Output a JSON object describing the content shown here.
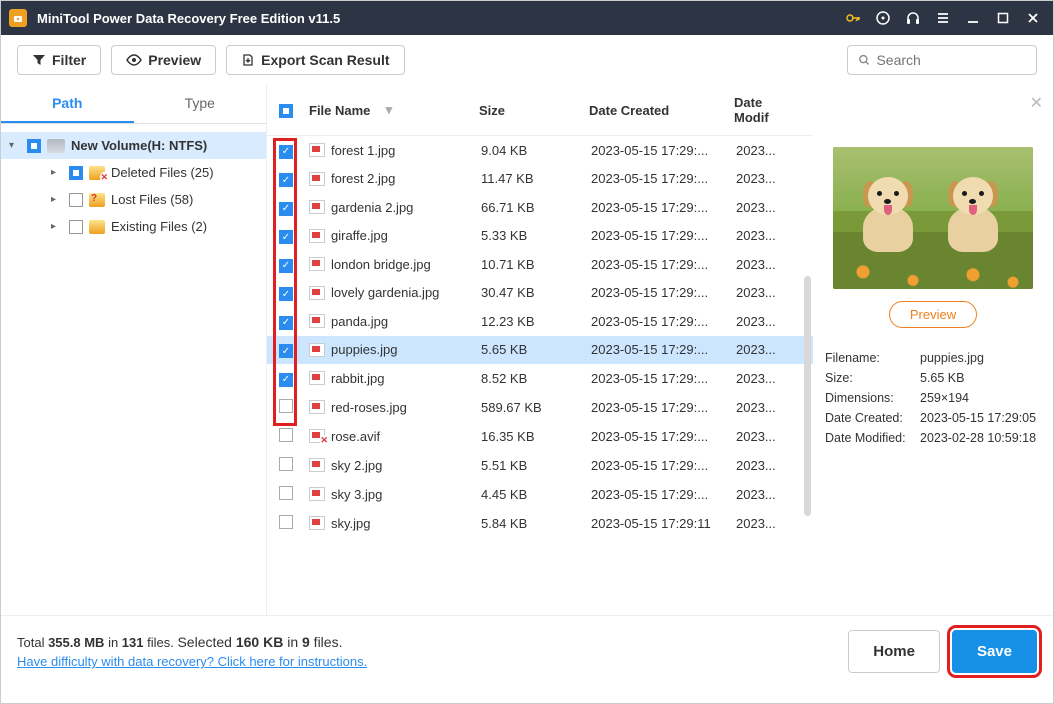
{
  "window": {
    "title": "MiniTool Power Data Recovery Free Edition v11.5"
  },
  "toolbar": {
    "filter": "Filter",
    "preview": "Preview",
    "export": "Export Scan Result",
    "search_placeholder": "Search"
  },
  "tabs": {
    "path": "Path",
    "type": "Type"
  },
  "tree": {
    "root": "New Volume(H: NTFS)",
    "items": [
      {
        "label": "Deleted Files (25)"
      },
      {
        "label": "Lost Files (58)"
      },
      {
        "label": "Existing Files (2)"
      }
    ]
  },
  "columns": {
    "name": "File Name",
    "size": "Size",
    "created": "Date Created",
    "modified": "Date Modif"
  },
  "files": [
    {
      "checked": true,
      "name": "forest 1.jpg",
      "size": "9.04 KB",
      "created": "2023-05-15 17:29:...",
      "modified": "2023...",
      "selected": false
    },
    {
      "checked": true,
      "name": "forest 2.jpg",
      "size": "11.47 KB",
      "created": "2023-05-15 17:29:...",
      "modified": "2023...",
      "selected": false
    },
    {
      "checked": true,
      "name": "gardenia 2.jpg",
      "size": "66.71 KB",
      "created": "2023-05-15 17:29:...",
      "modified": "2023...",
      "selected": false
    },
    {
      "checked": true,
      "name": "giraffe.jpg",
      "size": "5.33 KB",
      "created": "2023-05-15 17:29:...",
      "modified": "2023...",
      "selected": false
    },
    {
      "checked": true,
      "name": "london bridge.jpg",
      "size": "10.71 KB",
      "created": "2023-05-15 17:29:...",
      "modified": "2023...",
      "selected": false
    },
    {
      "checked": true,
      "name": "lovely gardenia.jpg",
      "size": "30.47 KB",
      "created": "2023-05-15 17:29:...",
      "modified": "2023...",
      "selected": false
    },
    {
      "checked": true,
      "name": "panda.jpg",
      "size": "12.23 KB",
      "created": "2023-05-15 17:29:...",
      "modified": "2023...",
      "selected": false
    },
    {
      "checked": true,
      "name": "puppies.jpg",
      "size": "5.65 KB",
      "created": "2023-05-15 17:29:...",
      "modified": "2023...",
      "selected": true
    },
    {
      "checked": true,
      "name": "rabbit.jpg",
      "size": "8.52 KB",
      "created": "2023-05-15 17:29:...",
      "modified": "2023...",
      "selected": false
    },
    {
      "checked": false,
      "name": "red-roses.jpg",
      "size": "589.67 KB",
      "created": "2023-05-15 17:29:...",
      "modified": "2023...",
      "selected": false
    },
    {
      "checked": false,
      "name": "rose.avif",
      "size": "16.35 KB",
      "created": "2023-05-15 17:29:...",
      "modified": "2023...",
      "selected": false,
      "bad": true
    },
    {
      "checked": false,
      "name": "sky 2.jpg",
      "size": "5.51 KB",
      "created": "2023-05-15 17:29:...",
      "modified": "2023...",
      "selected": false
    },
    {
      "checked": false,
      "name": "sky 3.jpg",
      "size": "4.45 KB",
      "created": "2023-05-15 17:29:...",
      "modified": "2023...",
      "selected": false
    },
    {
      "checked": false,
      "name": "sky.jpg",
      "size": "5.84 KB",
      "created": "2023-05-15 17:29:11",
      "modified": "2023...",
      "selected": false
    }
  ],
  "preview": {
    "button": "Preview",
    "meta": {
      "filename_k": "Filename:",
      "filename_v": "puppies.jpg",
      "size_k": "Size:",
      "size_v": "5.65 KB",
      "dim_k": "Dimensions:",
      "dim_v": "259×194",
      "created_k": "Date Created:",
      "created_v": "2023-05-15 17:29:05",
      "modified_k": "Date Modified:",
      "modified_v": "2023-02-28 10:59:18"
    }
  },
  "footer": {
    "total_prefix": "Total ",
    "total_size": "355.8 MB",
    "total_mid": " in ",
    "total_files": "131",
    "total_suffix": " files.  ",
    "selected_label": "Selected ",
    "selected_size": "160 KB",
    "selected_mid": " in ",
    "selected_files": "9",
    "selected_suffix": " files.",
    "help_link": "Have difficulty with data recovery? Click here for instructions.",
    "home": "Home",
    "save": "Save"
  }
}
